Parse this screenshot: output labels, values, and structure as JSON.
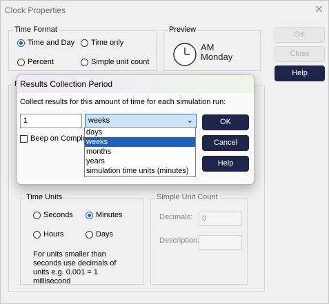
{
  "window": {
    "title": "Clock Properties",
    "close_glyph": "✕"
  },
  "time_format": {
    "label": "Time Format",
    "options": [
      "Time and Day",
      "Time only",
      "Percent",
      "Simple unit count"
    ],
    "selected": "Time and Day"
  },
  "preview": {
    "label": "Preview",
    "line1": "AM",
    "line2": "Monday",
    "icon": "clock-icon"
  },
  "side_buttons": {
    "ok": "OK",
    "close": "Close",
    "help": "Help"
  },
  "partial_group_label": "P",
  "time_units": {
    "label": "Time Units",
    "options": [
      "Seconds",
      "Minutes",
      "Hours",
      "Days"
    ],
    "selected": "Minutes",
    "note": [
      "For units smaller than",
      "seconds use decimals of",
      "units e.g. 0.001 = 1",
      "millisecond"
    ]
  },
  "simple_unit_count": {
    "label": "Simple Unit Count",
    "decimals_label": "Decimals:",
    "decimals_value": "0",
    "description_label": "Description:",
    "description_value": ""
  },
  "dialog": {
    "title": "Results Collection Period",
    "prompt": "Collect results for this amount of time for each simulation run:",
    "amount_value": "1",
    "period_selected": "weeks",
    "chevron": "⌄",
    "period_options": [
      "days",
      "weeks",
      "months",
      "years",
      "simulation time units (minutes)"
    ],
    "beep_label": "Beep on Complet",
    "buttons": {
      "ok": "OK",
      "cancel": "Cancel",
      "help": "Help"
    }
  }
}
